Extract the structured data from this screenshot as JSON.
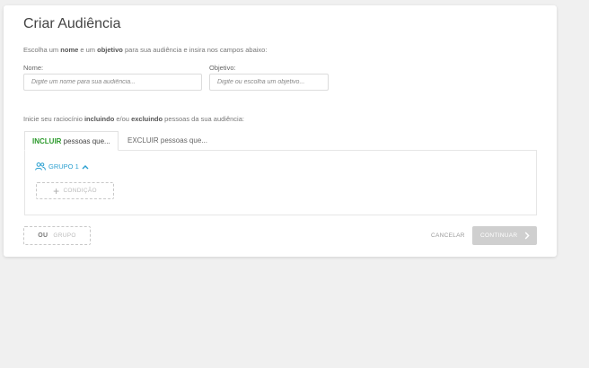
{
  "page": {
    "title": "Criar Audiência",
    "intro": {
      "p1": "Escolha um ",
      "b1": "nome",
      "p2": " e um ",
      "b2": "objetivo",
      "p3": " para sua audiência e insira nos campos abaixo:"
    },
    "name_field": {
      "label": "Nome:",
      "placeholder": "Digite um nome para sua audiência..."
    },
    "objective_field": {
      "label": "Objetivo:",
      "placeholder": "Digite ou escolha um objetivo..."
    },
    "intro2": {
      "p1": "Inicie seu raciocínio ",
      "b1": "incluindo",
      "p2": " e/ou ",
      "b2": "excluindo",
      "p3": " pessoas da sua audiência:"
    },
    "tabs": [
      {
        "strong": "INCLUIR",
        "rest": " pessoas que..."
      },
      {
        "label": "EXCLUIR pessoas que..."
      }
    ],
    "group": {
      "label": "GRUPO 1",
      "add_condition": "CONDIÇÃO"
    },
    "footer": {
      "ou": "OU",
      "grupo": "GRUPO",
      "cancel": "CANCELAR",
      "continue": "CONTINUAR"
    }
  },
  "colors": {
    "include_green": "#2c9a2c",
    "group_blue": "#2a9fd0",
    "disabled_button": "#cfcfcf"
  },
  "icons": {
    "group": "users-icon",
    "toggle": "chevron-up-icon",
    "add": "plus-icon",
    "next": "chevron-right-icon"
  }
}
